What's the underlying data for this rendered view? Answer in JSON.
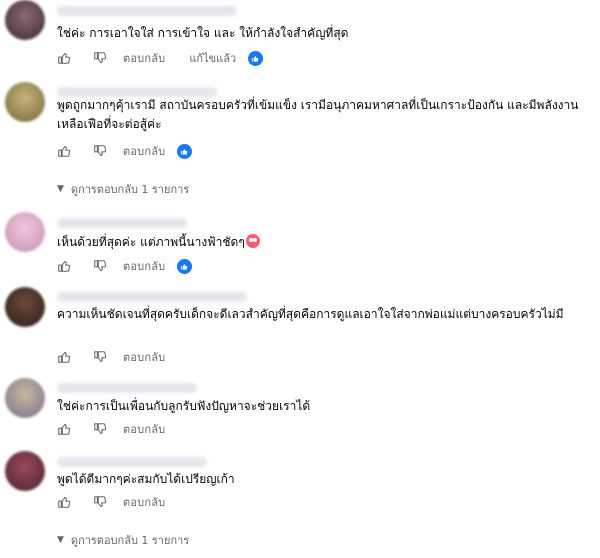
{
  "labels": {
    "reply": "ตอบกลับ",
    "edited": "แก้ไขแล้ว",
    "view_replies": "ดูการตอบกลับ 1 รายการ"
  },
  "colors": {
    "link_gray": "#606770",
    "like_blue": "#1877f2"
  },
  "icons": {
    "like": "thumbs-up-icon",
    "dislike": "thumbs-down-icon",
    "reaction": "blue-like-reaction-icon",
    "expand": "chevron-down-icon"
  },
  "comments": [
    {
      "text": "ใช่ค่ะ การเอาใจใส่ การเข้าใจ และ ให้กำลังใจสำคัญที่สุด"
    },
    {
      "text": "พูดถูกมากๆคุ้าเรามี สถาบันครอบครัวที่เข้มแข็ง เรามีอนุภาคมหาศาลที่เป็นเกราะป้องกัน และมีพลังงานเหลือเฟือที่จะต่อสู้ค่ะ"
    },
    {
      "text": "เห็นด้วยที่สุดค่ะ แต่ภาพนี้นางฟ้าชัดๆ"
    },
    {
      "text": "ความเห็นชัดเจนที่สุดครับเด็กจะดีเลวสำคัญที่สุดคือการดูแลเอาใจใส่จากพ่อแม่แต่บางครอบครัวไม่มี"
    },
    {
      "text": "ใช่ค่ะการเป็นเพื่อนกับลูกรับฟังปัญหาจะช่วยเราได้"
    },
    {
      "text": "พูดได้ดีมากๆค่ะสมกับได้เปรียญเก้า"
    }
  ]
}
